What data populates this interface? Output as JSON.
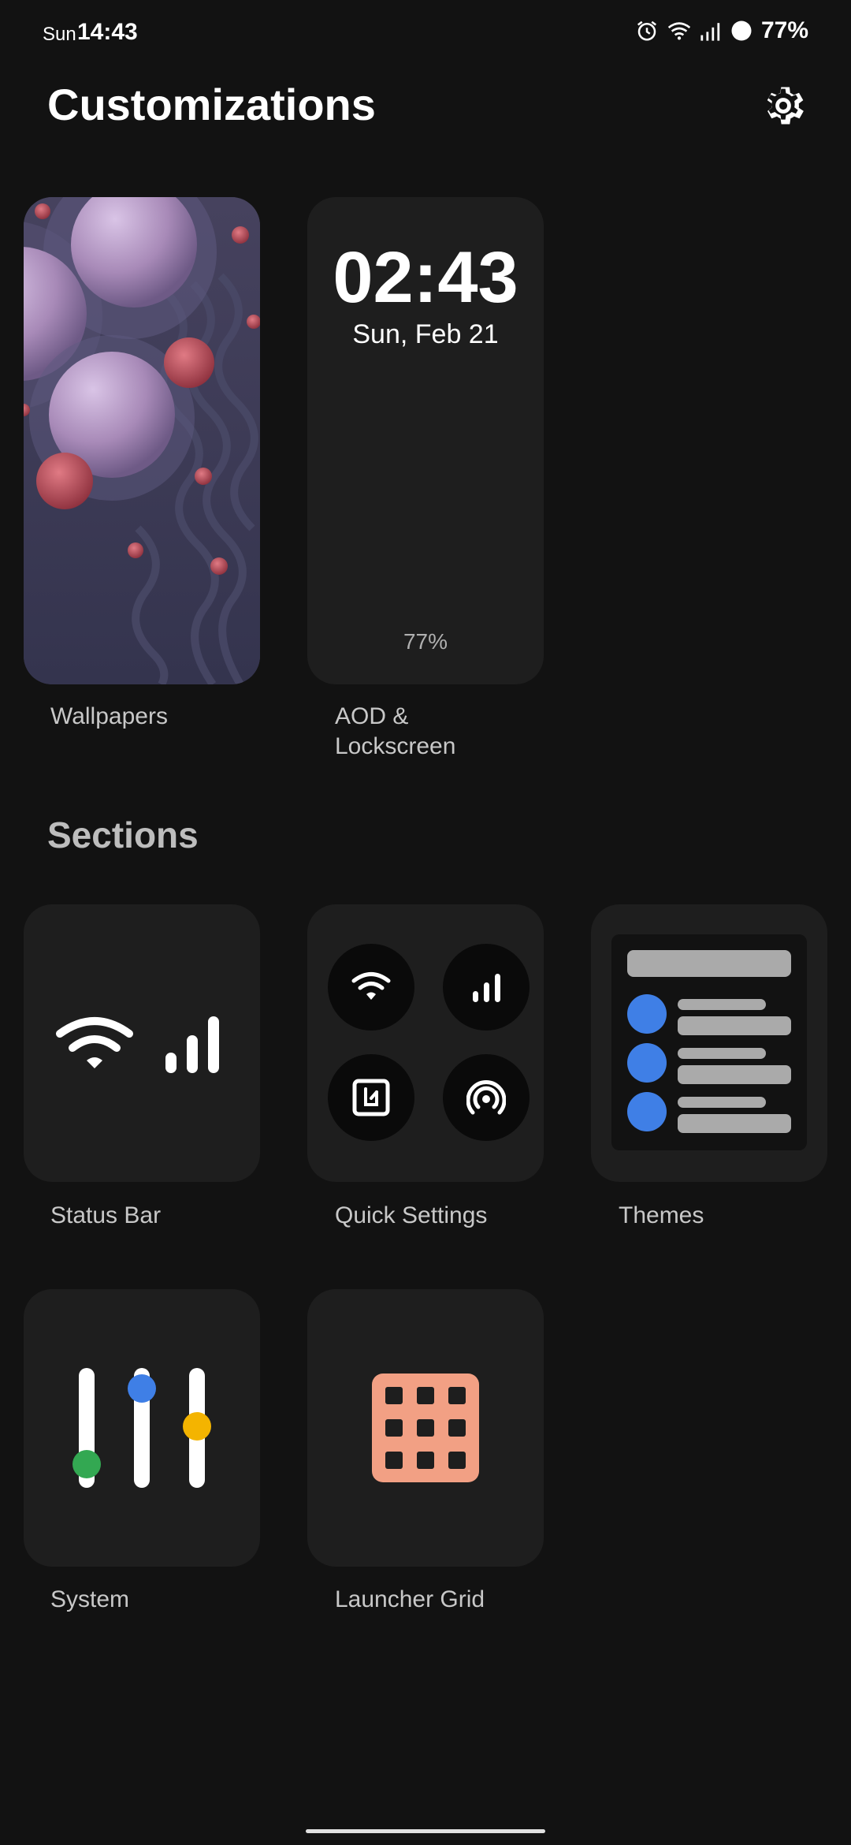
{
  "status_bar": {
    "day": "Sun",
    "time": "14:43",
    "battery": "77%"
  },
  "header": {
    "title": "Customizations"
  },
  "featured": {
    "wallpapers_label": "Wallpapers",
    "aod": {
      "time": "02:43",
      "date": "Sun, Feb 21",
      "battery": "77%",
      "label_line1": "AOD &",
      "label_line2": "Lockscreen"
    }
  },
  "sections": {
    "title": "Sections",
    "items": [
      {
        "label": "Status Bar"
      },
      {
        "label": "Quick Settings"
      },
      {
        "label": "Themes"
      },
      {
        "label": "System"
      },
      {
        "label": "Launcher Grid"
      }
    ]
  },
  "colors": {
    "accent_blue": "#3f7fe6",
    "green": "#33a852",
    "yellow": "#f4b400",
    "launcher_grid": "#f2a084"
  }
}
